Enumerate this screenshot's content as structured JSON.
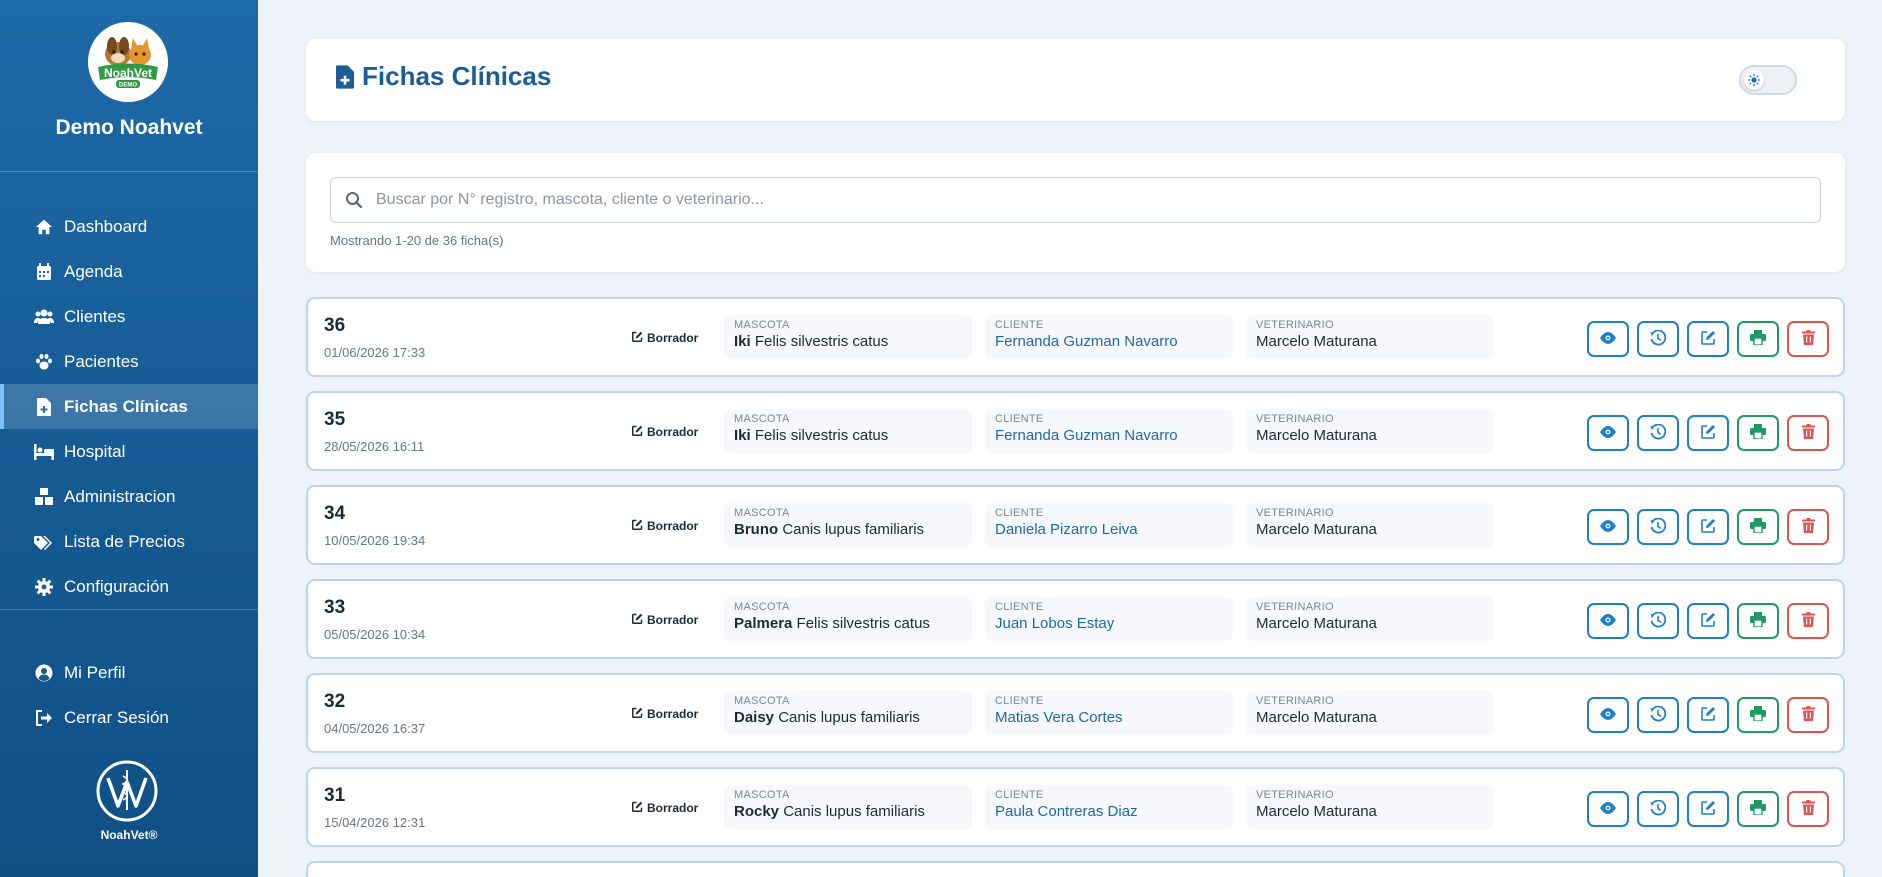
{
  "sidebar": {
    "brand_name": "Demo Noahvet",
    "logo_text": "NoahVet",
    "logo_subtext": "DEMO",
    "items": [
      {
        "label": "Dashboard",
        "icon": "home-icon"
      },
      {
        "label": "Agenda",
        "icon": "calendar-icon"
      },
      {
        "label": "Clientes",
        "icon": "users-icon"
      },
      {
        "label": "Pacientes",
        "icon": "paw-icon"
      },
      {
        "label": "Fichas Clínicas",
        "icon": "file-medical-icon",
        "active": true
      },
      {
        "label": "Hospital",
        "icon": "hospital-bed-icon"
      },
      {
        "label": "Administracion",
        "icon": "boxes-icon"
      },
      {
        "label": "Lista de Precios",
        "icon": "price-tag-icon"
      },
      {
        "label": "Configuración",
        "icon": "gear-icon"
      }
    ],
    "bottom_items": [
      {
        "label": "Mi Perfil",
        "icon": "user-circle-icon"
      },
      {
        "label": "Cerrar Sesión",
        "icon": "logout-icon"
      }
    ],
    "footer_text": "NoahVet®"
  },
  "header": {
    "title": "Fichas Clínicas"
  },
  "search": {
    "placeholder": "Buscar por N° registro, mascota, cliente o veterinario...",
    "value": "",
    "count_text": "Mostrando 1-20 de 36 ficha(s)"
  },
  "labels": {
    "mascota": "MASCOTA",
    "cliente": "CLIENTE",
    "veterinario": "VETERINARIO"
  },
  "records": [
    {
      "number": "36",
      "date": "01/06/2026 17:33",
      "status": "Borrador",
      "pet_name": "Iki",
      "species": "Felis silvestris catus",
      "client": "Fernanda Guzman Navarro",
      "vet": "Marcelo Maturana"
    },
    {
      "number": "35",
      "date": "28/05/2026 16:11",
      "status": "Borrador",
      "pet_name": "Iki",
      "species": "Felis silvestris catus",
      "client": "Fernanda Guzman Navarro",
      "vet": "Marcelo Maturana"
    },
    {
      "number": "34",
      "date": "10/05/2026 19:34",
      "status": "Borrador",
      "pet_name": "Bruno",
      "species": "Canis lupus familiaris",
      "client": "Daniela Pizarro Leiva",
      "vet": "Marcelo Maturana"
    },
    {
      "number": "33",
      "date": "05/05/2026 10:34",
      "status": "Borrador",
      "pet_name": "Palmera",
      "species": "Felis silvestris catus",
      "client": "Juan Lobos Estay",
      "vet": "Marcelo Maturana"
    },
    {
      "number": "32",
      "date": "04/05/2026 16:37",
      "status": "Borrador",
      "pet_name": "Daisy",
      "species": "Canis lupus familiaris",
      "client": "Matias Vera Cortes",
      "vet": "Marcelo Maturana"
    },
    {
      "number": "31",
      "date": "15/04/2026 12:31",
      "status": "Borrador",
      "pet_name": "Rocky",
      "species": "Canis lupus familiaris",
      "client": "Paula Contreras Diaz",
      "vet": "Marcelo Maturana"
    }
  ],
  "colors": {
    "primary": "#1d6aa8",
    "sidebar_bottom": "#104f86",
    "view_button": "#1d7fc4",
    "print_button": "#1f9a63",
    "delete_button": "#e05353"
  }
}
